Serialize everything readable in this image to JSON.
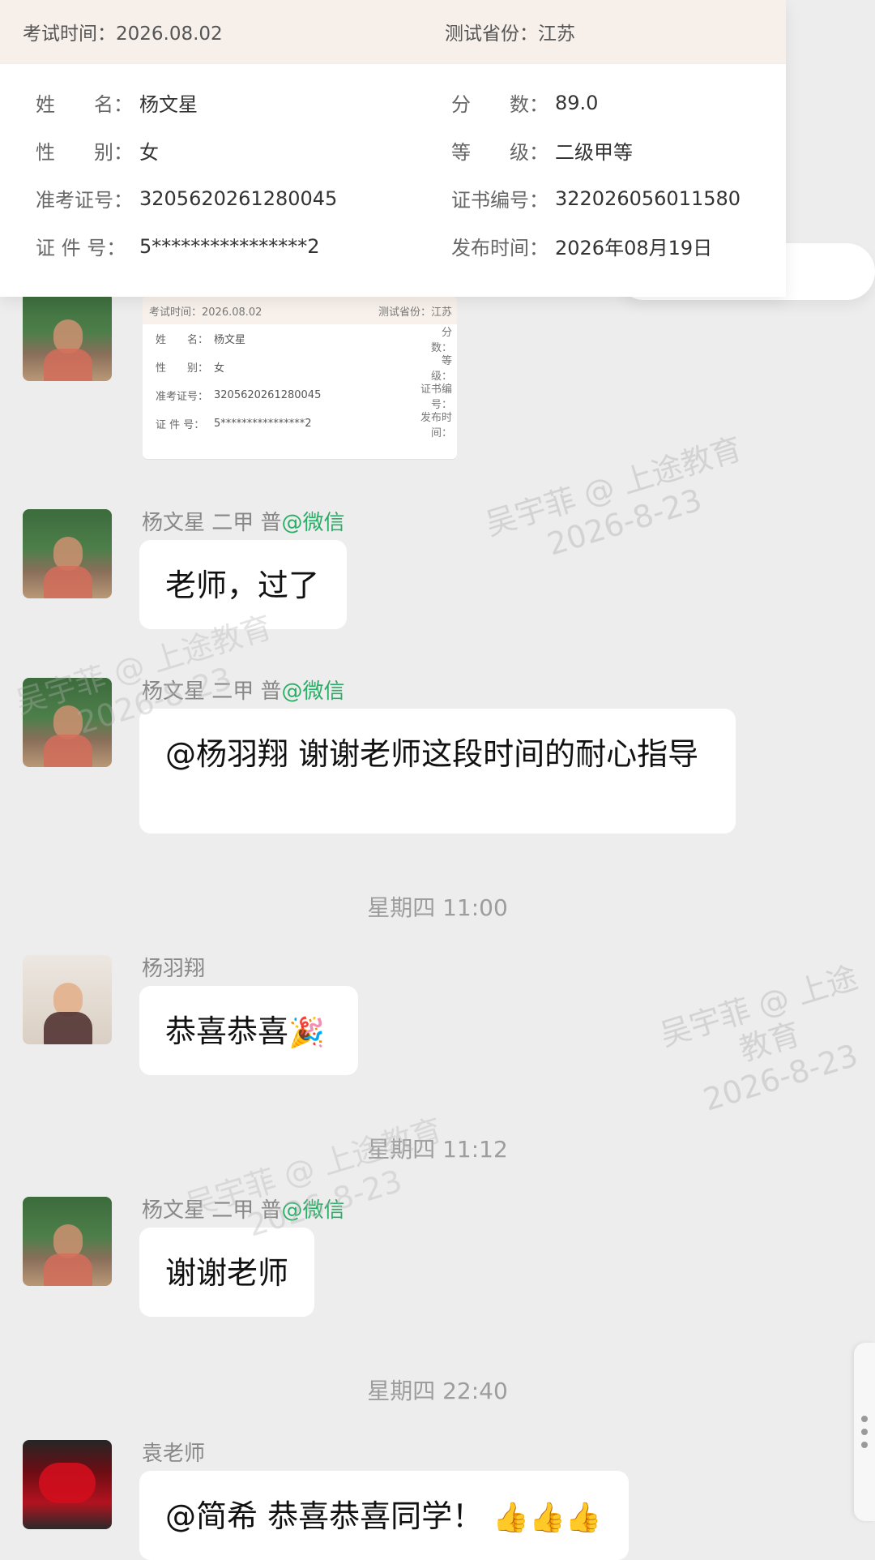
{
  "top_card": {
    "header": {
      "left": "考试时间：2026.08.02",
      "right": "测试省份：江苏"
    },
    "rows": [
      {
        "l_label": "姓　　名：",
        "l_value": "杨文星",
        "r_label": "分　　数：",
        "r_value": "89.0"
      },
      {
        "l_label": "性　　别：",
        "l_value": "女",
        "r_label": "等　　级：",
        "r_value": "二级甲等"
      },
      {
        "l_label": "准考证号：",
        "l_value": "3205620261280045",
        "r_label": "证书编号：",
        "r_value": "322026056011580"
      },
      {
        "l_label": "证 件 号：",
        "l_value": "5****************2",
        "r_label": "发布时间：",
        "r_value": "2026年08月19日"
      }
    ]
  },
  "thumb": {
    "header_left": "考试时间：2026.08.02",
    "header_right": "测试省份：江苏",
    "rows": [
      {
        "label": "姓　　名：",
        "value": "杨文星",
        "right": "分　　数："
      },
      {
        "label": "性　　别：",
        "value": "女",
        "right": "等　　级："
      },
      {
        "label": "准考证号：",
        "value": "3205620261280045",
        "right": "证书编号："
      },
      {
        "label": "证 件 号：",
        "value": "5****************2",
        "right": "发布时间："
      }
    ]
  },
  "messages": [
    {
      "sender": "杨文星 二甲 普",
      "tag": "@微信",
      "text": "老师，过了"
    },
    {
      "sender": "杨文星 二甲 普",
      "tag": "@微信",
      "text": "@杨羽翔 谢谢老师这段时间的耐心指导"
    },
    {
      "time": "星期四 11:00"
    },
    {
      "sender": "杨羽翔",
      "text": "恭喜恭喜",
      "emoji": "🎉"
    },
    {
      "time": "星期四 11:12"
    },
    {
      "sender": "杨文星 二甲 普",
      "tag": "@微信",
      "text": "谢谢老师"
    },
    {
      "time": "星期四 22:40"
    },
    {
      "sender": "袁老师",
      "text": "@简希 恭喜恭喜同学！",
      "emoji": "👍👍👍"
    }
  ],
  "watermark": {
    "line1": "吴宇菲 @ 上途教育",
    "line2": "2026-8-23"
  }
}
